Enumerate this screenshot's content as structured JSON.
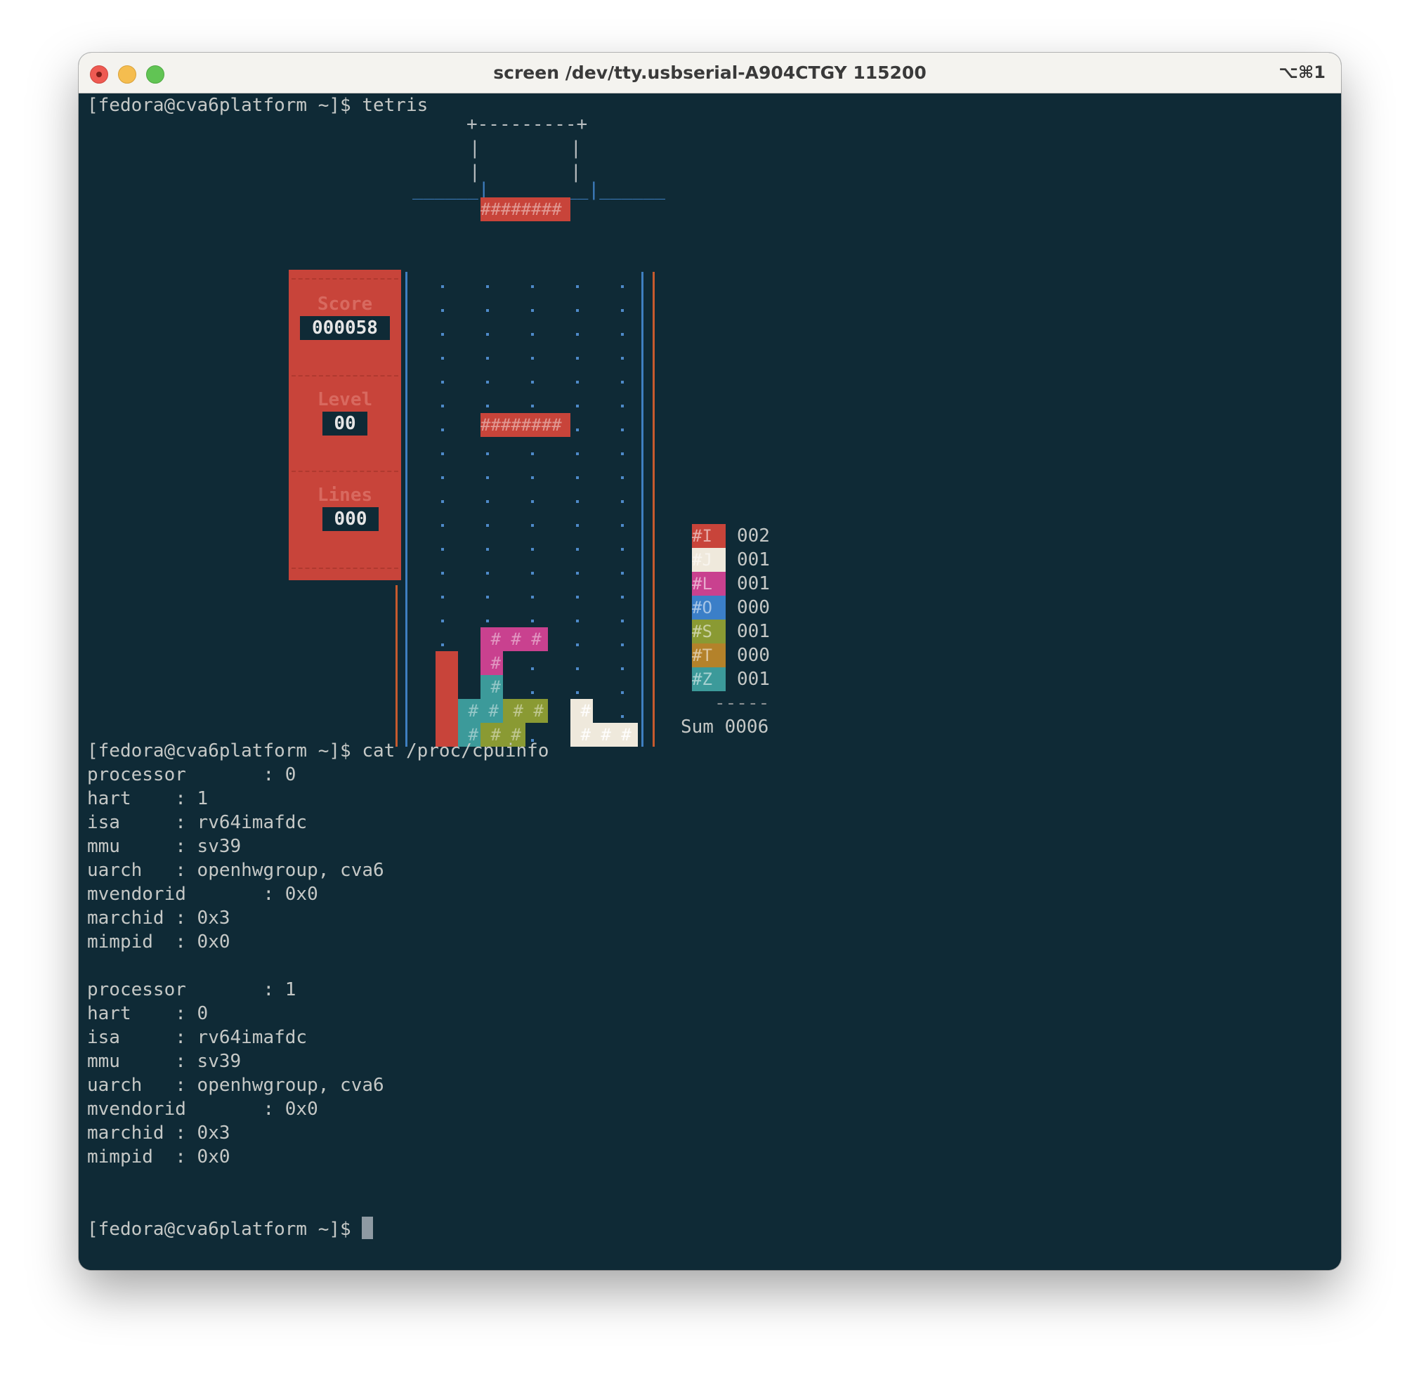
{
  "window": {
    "title": "screen /dev/tty.usbserial-A904CTGY 115200",
    "shortcut": "⌥⌘1"
  },
  "colors": {
    "background": "#0f2a36",
    "text": "#c5c8c6",
    "red": "#c8443a",
    "white": "#efe9dc",
    "magenta": "#c9418f",
    "blue": "#3b7fc8",
    "green": "#8a9a33",
    "orange": "#b4822a",
    "teal": "#3c9a9a"
  },
  "terminal": {
    "prompt_tetris": "[fedora@cva6platform ~]$ tetris",
    "prompt_cpuinfo": "[fedora@cva6platform ~]$ cat /proc/cpuinfo",
    "prompt_final": "[fedora@cva6platform ~]$ ",
    "cpuinfo": [
      "processor\t: 0",
      "hart\t: 1",
      "isa\t: rv64imafdc",
      "mmu\t: sv39",
      "uarch\t: openhwgroup, cva6",
      "mvendorid\t: 0x0",
      "marchid\t: 0x3",
      "mimpid\t: 0x0",
      "",
      "processor\t: 1",
      "hart\t: 0",
      "isa\t: rv64imafdc",
      "mmu\t: sv39",
      "uarch\t: openhwgroup, cva6",
      "mvendorid\t: 0x0",
      "marchid\t: 0x3",
      "mimpid\t: 0x0"
    ]
  },
  "tetris": {
    "preview_top": "+---------+",
    "preview_side": "|",
    "preview_bottom": "______|_________|______",
    "score_label": "Score",
    "score_value": "000058",
    "level_label": "Level",
    "level_value": "00",
    "lines_label": "Lines",
    "lines_value": "000",
    "next_piece_text": "########",
    "falling_piece_text": "########",
    "stats": [
      {
        "piece": "#I",
        "count": "002",
        "color": "#c8443a"
      },
      {
        "piece": "#J",
        "count": "001",
        "color": "#efe9dc"
      },
      {
        "piece": "#L",
        "count": "001",
        "color": "#c9418f"
      },
      {
        "piece": "#O",
        "count": "000",
        "color": "#3b7fc8"
      },
      {
        "piece": "#S",
        "count": "001",
        "color": "#8a9a33"
      },
      {
        "piece": "#T",
        "count": "000",
        "color": "#b4822a"
      },
      {
        "piece": "#Z",
        "count": "001",
        "color": "#3c9a9a"
      }
    ],
    "sum_divider": "-----",
    "sum_label": "Sum 0006"
  }
}
